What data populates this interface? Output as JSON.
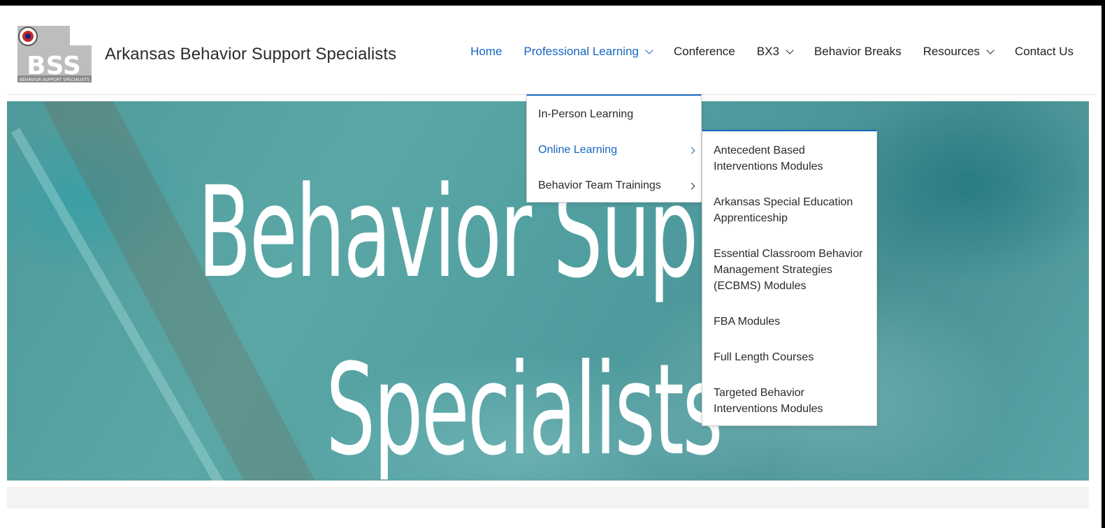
{
  "header": {
    "logo_text": "BSS",
    "logo_subtext": "BEHAVIOR SUPPORT SPECIALISTS",
    "site_title": "Arkansas Behavior Support Specialists"
  },
  "nav": {
    "items": [
      {
        "label": "Home",
        "active": true,
        "has_dropdown": false
      },
      {
        "label": "Professional Learning",
        "active": true,
        "has_dropdown": true
      },
      {
        "label": "Conference",
        "active": false,
        "has_dropdown": false
      },
      {
        "label": "BX3",
        "active": false,
        "has_dropdown": true
      },
      {
        "label": "Behavior Breaks",
        "active": false,
        "has_dropdown": false
      },
      {
        "label": "Resources",
        "active": false,
        "has_dropdown": true
      },
      {
        "label": "Contact Us",
        "active": false,
        "has_dropdown": false
      }
    ]
  },
  "dropdown": {
    "items": [
      {
        "label": "In-Person Learning",
        "has_submenu": false
      },
      {
        "label": "Online Learning",
        "has_submenu": true,
        "active": true
      },
      {
        "label": "Behavior Team Trainings",
        "has_submenu": true
      }
    ]
  },
  "submenu": {
    "items": [
      {
        "label": "Antecedent Based Interventions Modules"
      },
      {
        "label": "Arkansas Special Education Apprenticeship"
      },
      {
        "label": "Essential Classroom Behavior Management Strategies (ECBMS) Modules"
      },
      {
        "label": "FBA Modules"
      },
      {
        "label": "Full Length Courses"
      },
      {
        "label": "Targeted Behavior Interventions Modules"
      }
    ]
  },
  "hero": {
    "title_line1": "Behavior Support",
    "title_line2": "Specialists"
  },
  "colors": {
    "accent": "#1565c0",
    "text": "#222222",
    "hero_tint": "#4e9a9b"
  }
}
